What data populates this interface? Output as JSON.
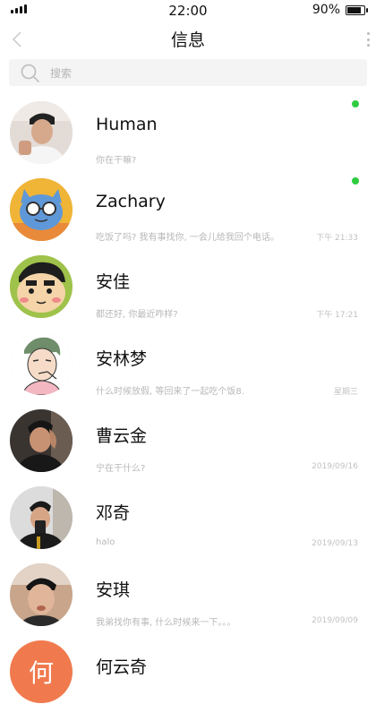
{
  "status_bar": {
    "time": "22:00",
    "battery_percent": "90%",
    "battery_level": 0.9
  },
  "header": {
    "title": "信息",
    "back_icon": "chevron-left-icon",
    "more_icon": "vertical-dots-icon"
  },
  "search": {
    "placeholder": "搜索",
    "icon": "search-icon"
  },
  "conversations": [
    {
      "name": "Human",
      "preview": "你在干嘛?",
      "time": "",
      "unread": true,
      "avatar_bg": "#d9cfc8"
    },
    {
      "name": "Zachary",
      "preview": "吃饭了吗? 我有事找你, 一会儿给我回个电话。",
      "time": "",
      "unread": true,
      "avatar_bg": "#f0b437"
    },
    {
      "name": "安佳",
      "preview": "都还好, 你最近咋样?",
      "time": "下午 21:33",
      "unread": false,
      "avatar_bg": "#9ec24a"
    },
    {
      "name": "安林梦",
      "preview": "什么时候放假, 等回来了一起吃个饭8.",
      "time": "下午 17:21",
      "unread": false,
      "avatar_bg": "#ffffff"
    },
    {
      "name": "曹云金",
      "preview": "宁在干什么?",
      "time": "星期三",
      "unread": false,
      "avatar_bg": "#3a3430"
    },
    {
      "name": "邓奇",
      "preview": "halo",
      "time": "2019/09/16",
      "unread": false,
      "avatar_bg": "#dcdcdc"
    },
    {
      "name": "安琪",
      "preview": "我弟找你有事, 什么时候来一下。。。",
      "time": "2019/09/13",
      "unread": false,
      "avatar_bg": "#c8a58b"
    },
    {
      "name": "何云奇",
      "preview": "",
      "time": "2019/09/09",
      "unread": false,
      "avatar_bg": "#f07a4e",
      "avatar_letter": "何"
    }
  ],
  "colors": {
    "unread_dot": "#2ecc40",
    "search_bg": "#f4f4f4",
    "secondary_text": "#b8b8b8"
  }
}
